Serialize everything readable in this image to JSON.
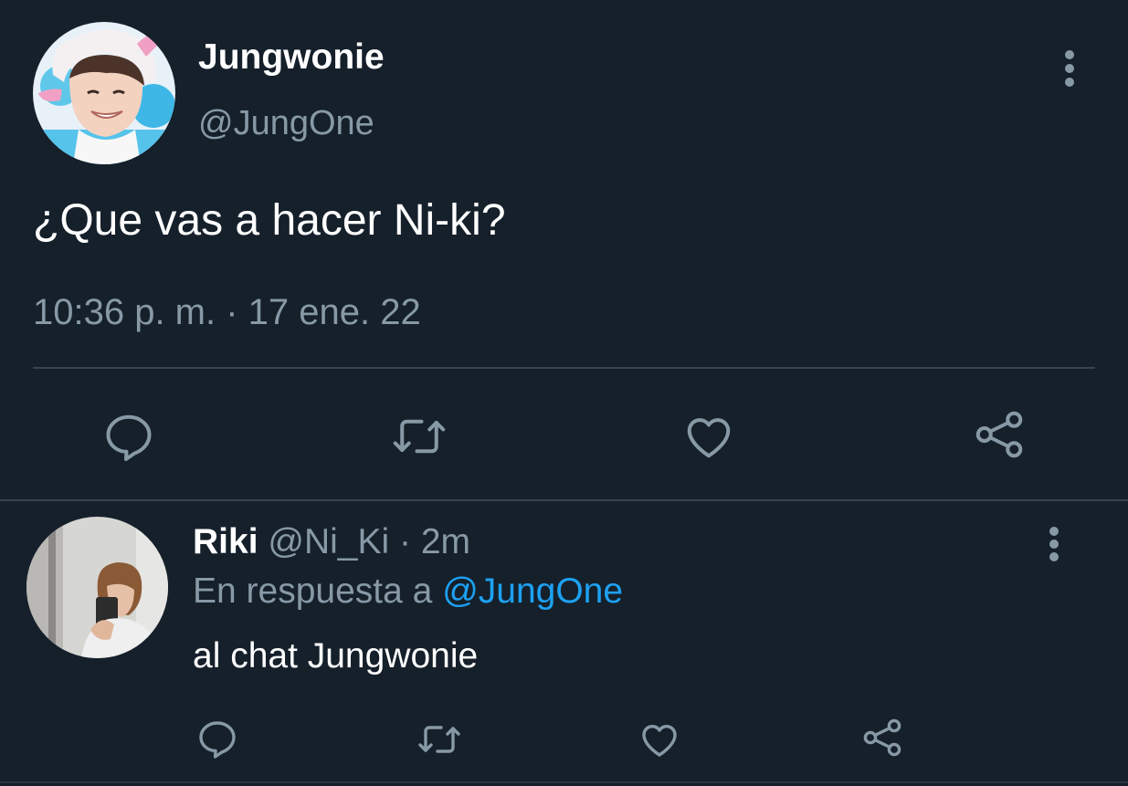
{
  "theme": {
    "background": "#15202b",
    "primary_text": "#ffffff",
    "secondary_text": "#8899a6",
    "link": "#1da1f2",
    "divider": "#38444d"
  },
  "main_tweet": {
    "display_name": "Jungwonie",
    "handle": "@JungOne",
    "text": "¿Que vas a hacer Ni-ki?",
    "timestamp": "10:36 p. m. · 17 ene. 22",
    "actions": [
      "reply-icon",
      "retweet-icon",
      "like-icon",
      "share-icon"
    ]
  },
  "reply": {
    "display_name": "Riki",
    "handle": "@Ni_Ki",
    "separator": " · ",
    "time": "2m",
    "context_prefix": "En respuesta a",
    "context_mention": "@JungOne",
    "text": "al chat Jungwonie",
    "actions": [
      "reply-icon",
      "retweet-icon",
      "like-icon",
      "share-icon"
    ]
  }
}
